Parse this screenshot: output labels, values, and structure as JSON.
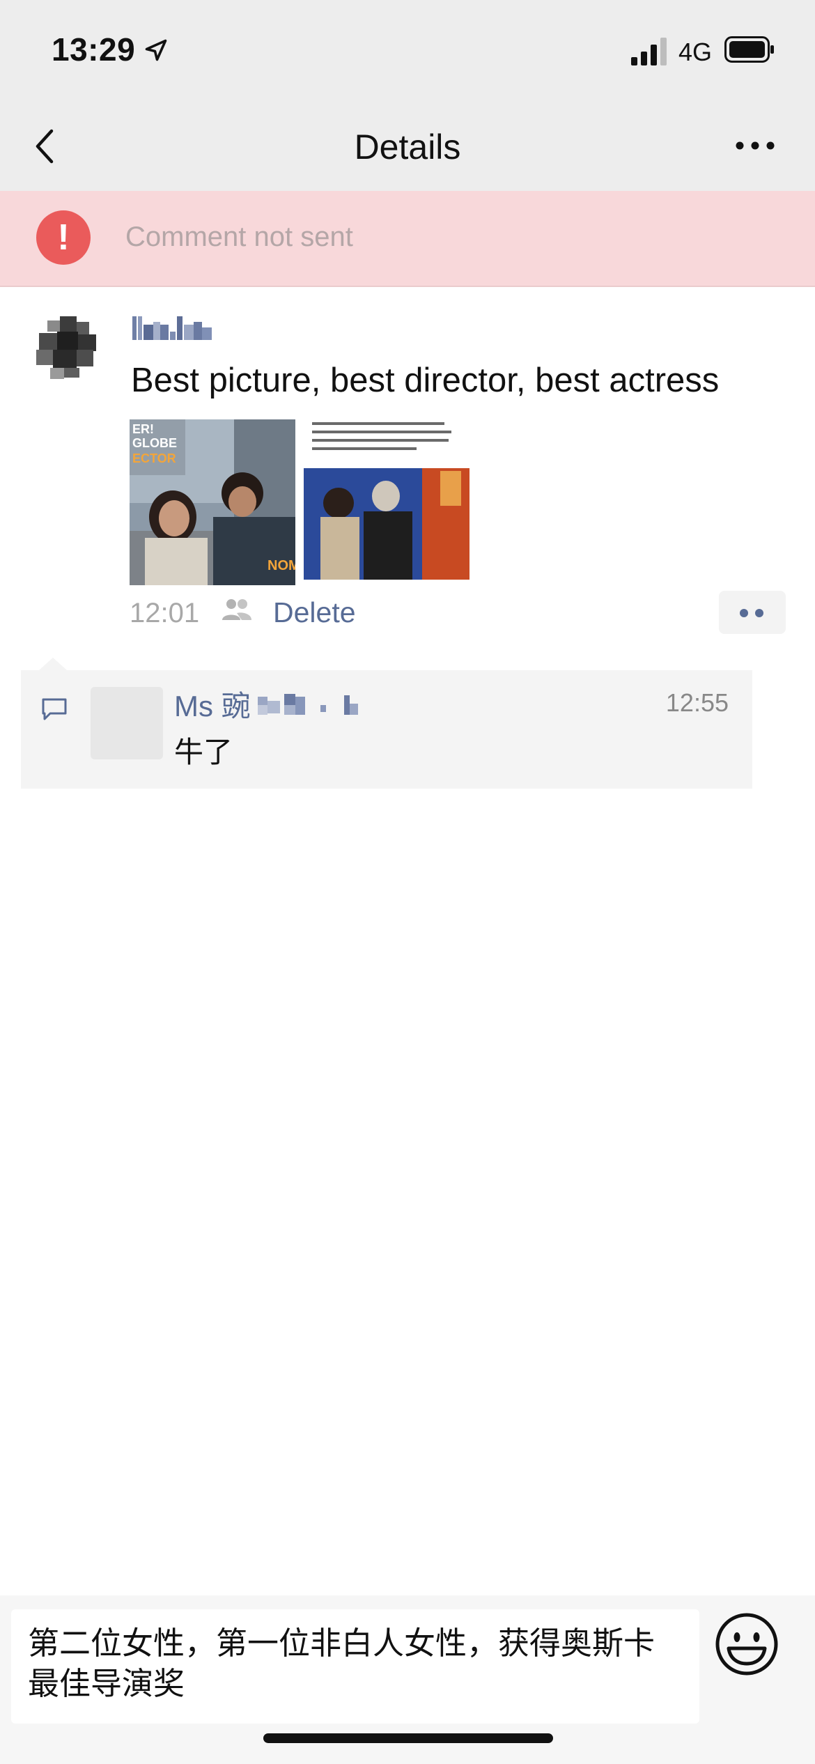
{
  "status_bar": {
    "time": "13:29",
    "network": "4G"
  },
  "nav": {
    "title": "Details"
  },
  "error_banner": {
    "text": "Comment not sent"
  },
  "post": {
    "text": "Best picture, best director, best actress",
    "time": "12:01",
    "delete_label": "Delete"
  },
  "comment": {
    "author_prefix": "Ms 豌",
    "time": "12:55",
    "text": "牛了"
  },
  "composer": {
    "value": "第二位女性，第一位非白人女性，获得奥斯卡最佳导演奖"
  },
  "colors": {
    "link": "#576b95",
    "error_bg": "#f8d8da",
    "error_icon": "#ea5b5b",
    "bar_bg": "#ededed"
  }
}
